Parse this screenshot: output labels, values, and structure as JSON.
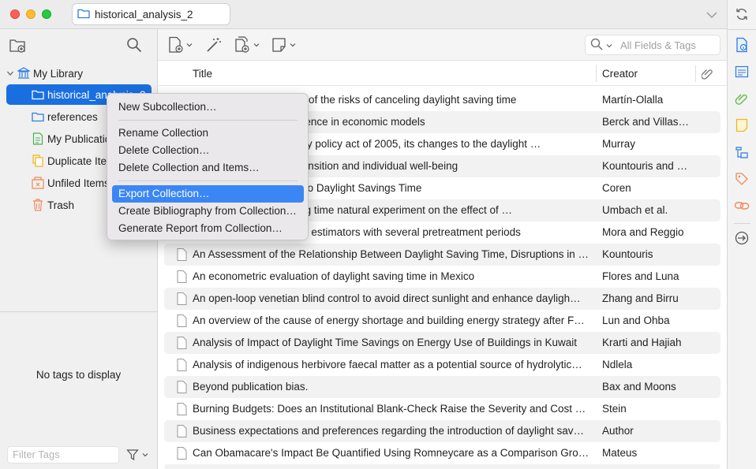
{
  "window": {
    "tab_title": "historical_analysis_2"
  },
  "colors": {
    "selection": "#1a6fe0",
    "menu_highlight": "#3b86f5",
    "folder_icon": "#2b7be4",
    "note_icon": "#f5b31b",
    "tag_icon": "#f08a58",
    "attachment_icon": "#72c05b"
  },
  "left_pane": {
    "library_label": "My Library",
    "tree": [
      {
        "label": "historical_analysis_2",
        "icon": "folder-icon"
      },
      {
        "label": "references",
        "icon": "folder-icon"
      },
      {
        "label": "My Publications",
        "icon": "publications-icon"
      },
      {
        "label": "Duplicate Items",
        "icon": "duplicate-icon"
      },
      {
        "label": "Unfiled Items",
        "icon": "unfiled-icon"
      },
      {
        "label": "Trash",
        "icon": "trash-icon"
      }
    ],
    "no_tags": "No tags to display",
    "filter_tags_placeholder": "Filter Tags"
  },
  "toolbar": {
    "search_placeholder": "All Fields & Tags"
  },
  "columns": {
    "title": "Title",
    "creator": "Creator"
  },
  "items": [
    {
      "title": "A preliminary estimation of the risks of canceling daylight saving time",
      "creator": "Martín-Olalla"
    },
    {
      "title": "Accounting for the difference in economic models",
      "creator": "Berck and Villas…"
    },
    {
      "title": "An analysis of the energy policy act of 2005, its changes to the daylight …",
      "creator": "Murray"
    },
    {
      "title": "Daylight Saving Time transition and individual well-being",
      "creator": "Kountouris and …"
    },
    {
      "title": "Accidents and the Shift to Daylight Savings Time",
      "creator": "Coren"
    },
    {
      "title": "Using the daylight saving time natural experiment on the effect of …",
      "creator": "Umbach et al."
    },
    {
      "title": "Difference-in-differences estimators with several pretreatment periods",
      "creator": "Mora and Reggio"
    },
    {
      "title": "An Assessment of the Relationship Between Daylight Saving Time, Disruptions in …",
      "creator": "Kountouris"
    },
    {
      "title": "An econometric evaluation of daylight saving time in Mexico",
      "creator": "Flores and Luna"
    },
    {
      "title": "An open-loop venetian blind control to avoid direct sunlight and enhance dayligh…",
      "creator": "Zhang and Birru"
    },
    {
      "title": "An overview of the cause of energy shortage and building energy strategy after F…",
      "creator": "Lun and Ohba"
    },
    {
      "title": "Analysis of Impact of Daylight Time Savings on Energy Use of Buildings in Kuwait",
      "creator": "Krarti and Hajiah"
    },
    {
      "title": "Analysis of indigenous herbivore faecal matter as a potential source of hydrolytic…",
      "creator": "Ndlela"
    },
    {
      "title": "Beyond publication bias.",
      "creator": "Bax and Moons"
    },
    {
      "title": "Burning Budgets: Does an Institutional Blank-Check Raise the Severity and Cost …",
      "creator": "Stein"
    },
    {
      "title": "Business expectations and preferences regarding the introduction of daylight sav…",
      "creator": "Author"
    },
    {
      "title": "Can Obamacare's Impact Be Quantified Using Romneycare as a Comparison Gro…",
      "creator": "Mateus"
    }
  ],
  "context_menu": {
    "items": [
      "New Subcollection…",
      "Rename Collection",
      "Delete Collection…",
      "Delete Collection and Items…",
      "Export Collection…",
      "Create Bibliography from Collection…",
      "Generate Report from Collection…"
    ],
    "highlighted": "Export Collection…"
  }
}
